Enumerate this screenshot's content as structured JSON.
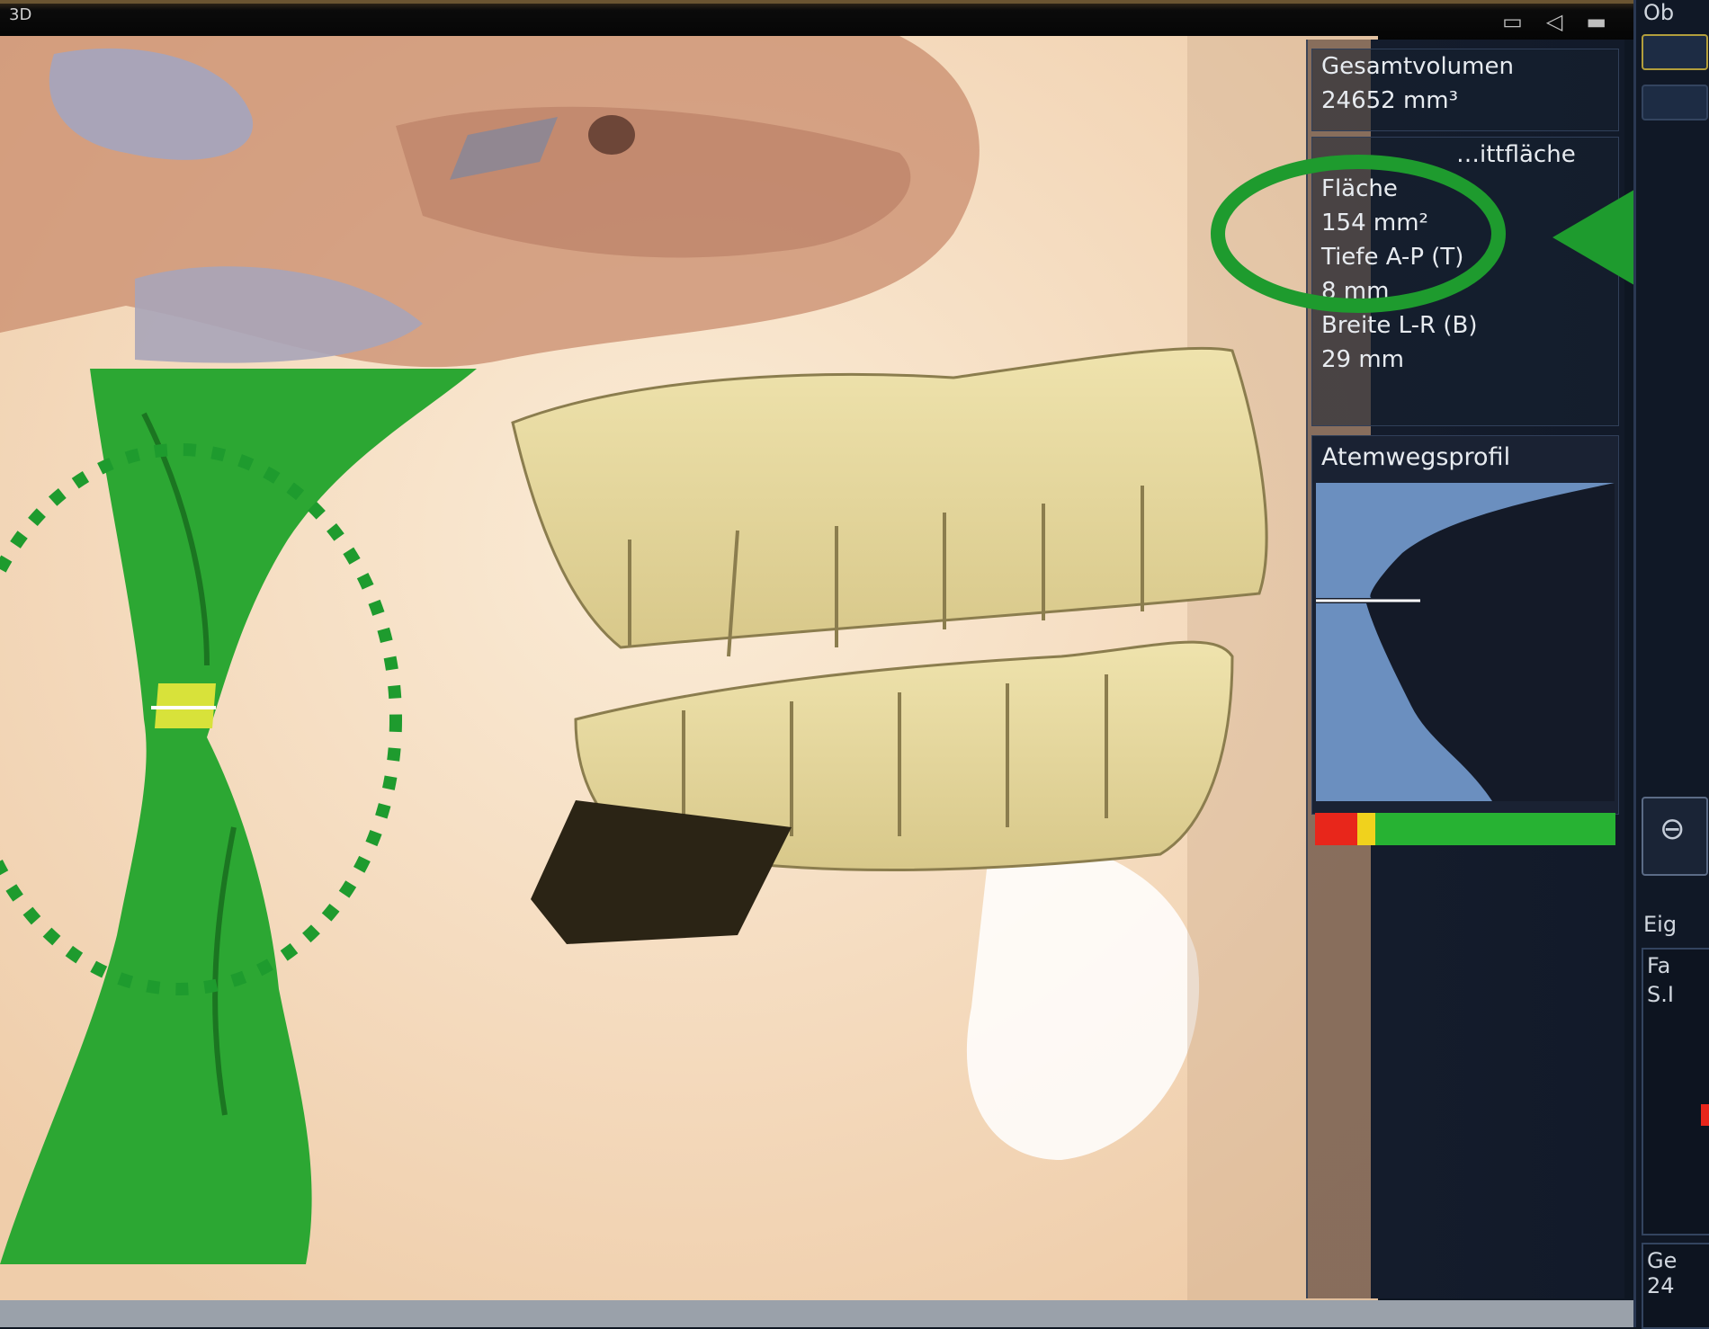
{
  "window": {
    "title": "3D",
    "icons": [
      "screenshot-icon",
      "speaker-icon",
      "window-icon"
    ]
  },
  "info": {
    "total_volume_label": "Gesamtvolumen",
    "total_volume_value": "24652 mm³",
    "cross_section_label": "…ittfläche",
    "area_label": "Fläche",
    "area_value": "154 mm²",
    "depth_label": "Tiefe A-P (T)",
    "depth_value": "8 mm",
    "width_label": "Breite L-R (B)",
    "width_value": "29 mm"
  },
  "profile": {
    "title": "Atemwegsprofil",
    "colors": {
      "background": "#141a28",
      "fill": "#6b8fbf",
      "marker": "#ffffff"
    }
  },
  "severity": {
    "segments": [
      {
        "color": "#e8261b",
        "fraction": 0.14
      },
      {
        "color": "#f0d21d",
        "fraction": 0.06
      },
      {
        "color": "#27b233",
        "fraction": 0.8
      }
    ]
  },
  "right_strip": {
    "top_label": "Ob",
    "section_label": "Eig",
    "row1": "Fa",
    "row2": "S.I",
    "bottom_label1": "Ge",
    "bottom_label2": "24"
  },
  "annotation": {
    "color": "#1e9b2e"
  }
}
